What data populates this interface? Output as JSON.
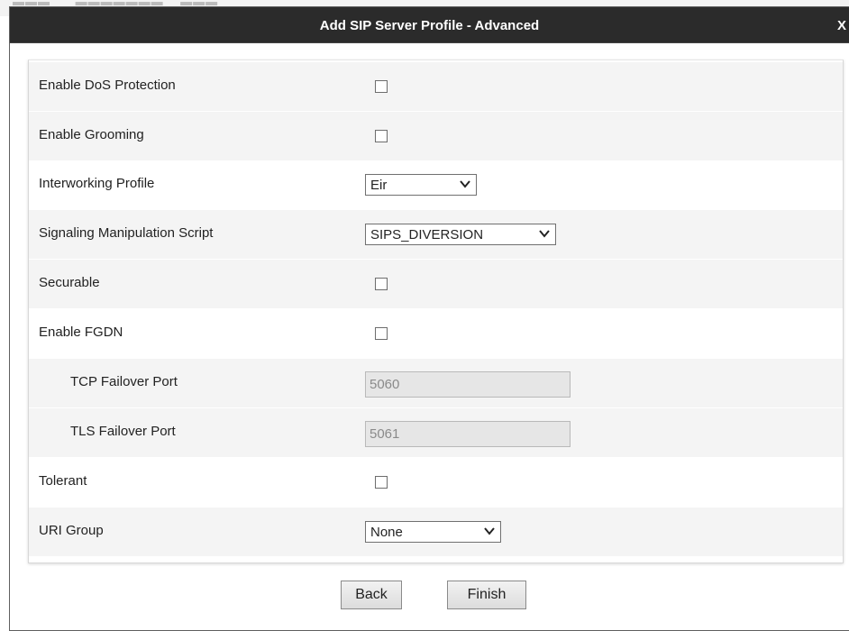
{
  "dialog": {
    "title": "Add SIP Server Profile - Advanced",
    "close_label": "X"
  },
  "rows": {
    "dos": {
      "label": "Enable DoS Protection",
      "checked": false
    },
    "grooming": {
      "label": "Enable Grooming",
      "checked": false
    },
    "interworking": {
      "label": "Interworking Profile",
      "value": "Eir"
    },
    "script": {
      "label": "Signaling Manipulation Script",
      "value": "SIPS_DIVERSION"
    },
    "securable": {
      "label": "Securable",
      "checked": false
    },
    "fgdn": {
      "label": "Enable FGDN",
      "checked": false
    },
    "tcp": {
      "label": "TCP Failover Port",
      "value": "5060"
    },
    "tls": {
      "label": "TLS Failover Port",
      "value": "5061"
    },
    "tolerant": {
      "label": "Tolerant",
      "checked": false
    },
    "uri": {
      "label": "URI Group",
      "value": "None"
    }
  },
  "buttons": {
    "back": "Back",
    "finish": "Finish"
  }
}
